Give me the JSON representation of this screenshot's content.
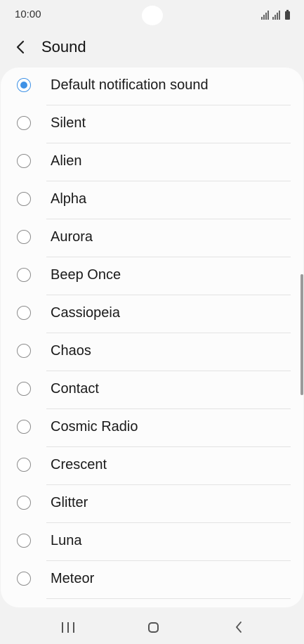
{
  "status_bar": {
    "time": "10:00"
  },
  "header": {
    "title": "Sound"
  },
  "sounds": [
    {
      "label": "Default notification sound",
      "selected": true
    },
    {
      "label": "Silent",
      "selected": false
    },
    {
      "label": "Alien",
      "selected": false
    },
    {
      "label": "Alpha",
      "selected": false
    },
    {
      "label": "Aurora",
      "selected": false
    },
    {
      "label": "Beep Once",
      "selected": false
    },
    {
      "label": "Cassiopeia",
      "selected": false
    },
    {
      "label": "Chaos",
      "selected": false
    },
    {
      "label": "Contact",
      "selected": false
    },
    {
      "label": "Cosmic Radio",
      "selected": false
    },
    {
      "label": "Crescent",
      "selected": false
    },
    {
      "label": "Glitter",
      "selected": false
    },
    {
      "label": "Luna",
      "selected": false
    },
    {
      "label": "Meteor",
      "selected": false
    }
  ],
  "colors": {
    "accent": "#3e91e6",
    "background": "#f2f2f2",
    "card": "#fcfcfc"
  },
  "icons": {
    "back": "chevron-left-icon",
    "recents": "recents-icon",
    "home": "home-icon",
    "nav_back": "nav-back-icon"
  }
}
